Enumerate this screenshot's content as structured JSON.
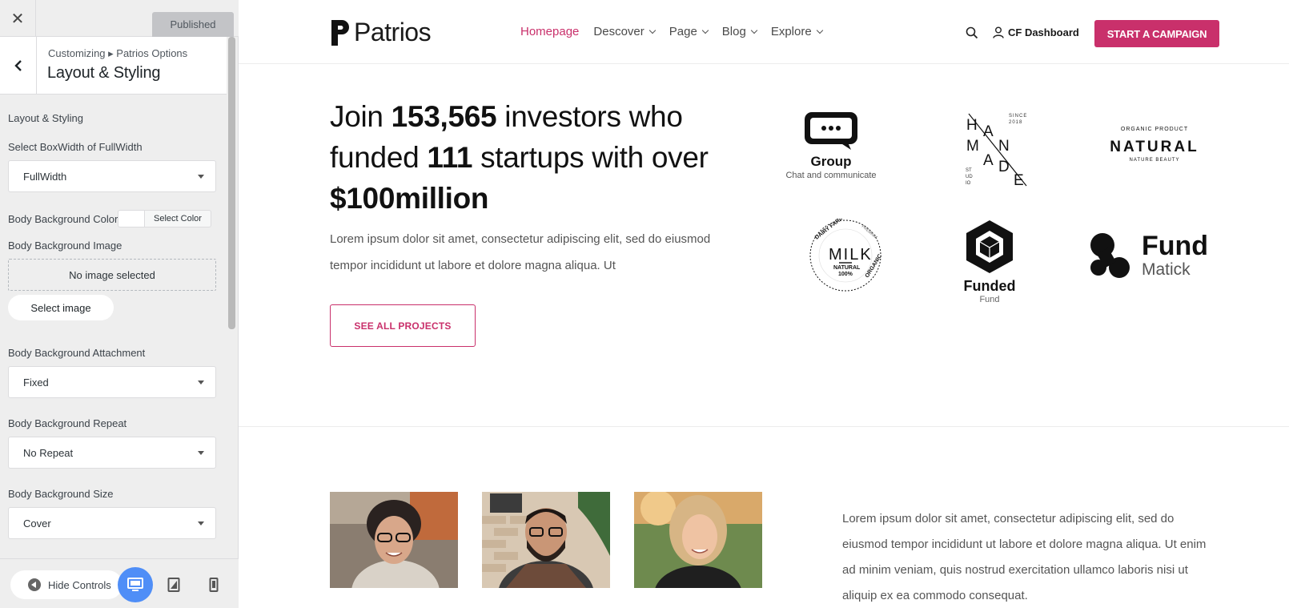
{
  "customizer": {
    "close_label": "✕",
    "publish_label": "Published",
    "breadcrumb": "Customizing ▸ Patrios Options",
    "section_title": "Layout & Styling",
    "group_heading": "Layout & Styling",
    "fields": {
      "box_width": {
        "label": "Select BoxWidth of FullWidth",
        "value": "FullWidth"
      },
      "bg_color": {
        "label": "Body Background Color",
        "button": "Select Color"
      },
      "bg_image": {
        "label": "Body Background Image",
        "empty_text": "No image selected",
        "button": "Select image"
      },
      "bg_attachment": {
        "label": "Body Background Attachment",
        "value": "Fixed"
      },
      "bg_repeat": {
        "label": "Body Background Repeat",
        "value": "No Repeat"
      },
      "bg_size": {
        "label": "Body Background Size",
        "value": "Cover"
      }
    },
    "footer": {
      "hide_controls": "Hide Controls"
    }
  },
  "site": {
    "logo_text": "Patrios",
    "nav": [
      {
        "label": "Homepage",
        "active": true,
        "dropdown": false
      },
      {
        "label": "Descover",
        "active": false,
        "dropdown": true
      },
      {
        "label": "Page",
        "active": false,
        "dropdown": true
      },
      {
        "label": "Blog",
        "active": false,
        "dropdown": true
      },
      {
        "label": "Explore",
        "active": false,
        "dropdown": true
      }
    ],
    "dashboard_link": "CF Dashboard",
    "cta_button": "START A CAMPAIGN",
    "accent_color": "#c9306b",
    "hero": {
      "h_part1": "Join ",
      "h_investors": "153,565",
      "h_part2": " investors who funded ",
      "h_startups": "111",
      "h_part3": " startups with over ",
      "h_amount": "$100million",
      "paragraph": "Lorem ipsum dolor sit amet, consectetur adipiscing elit, sed do eiusmod tempor incididunt ut labore et dolore magna aliqua. Ut",
      "button": "SEE ALL PROJECTS"
    },
    "brands": {
      "group": {
        "name": "Group",
        "tagline": "Chat and communicate"
      },
      "handmade": {
        "letters": "HANDMADE",
        "since": "SINCE",
        "year": "2018",
        "studio": "STUDIO"
      },
      "natural": {
        "top": "ORGANIC PRODUCT",
        "name": "NATURAL",
        "tagline": "NATURE BEAUTY"
      },
      "milk": {
        "ring_top": "DAIRY FARM",
        "ring_right": "PREMIUM PRODUCT",
        "ring_bottom": "ORGANIC",
        "name": "MILK",
        "sub1": "NATURAL",
        "sub2": "100%"
      },
      "funded": {
        "name": "Funded",
        "tagline": "Fund"
      },
      "fundmatick": {
        "name": "Fund",
        "tagline": "Matick"
      }
    },
    "about_paragraph": "Lorem ipsum dolor sit amet, consectetur adipiscing elit, sed do eiusmod tempor incididunt ut labore et dolore magna aliqua. Ut enim ad minim veniam, quis nostrud exercitation ullamco laboris nisi ut aliquip ex ea commodo consequat."
  }
}
